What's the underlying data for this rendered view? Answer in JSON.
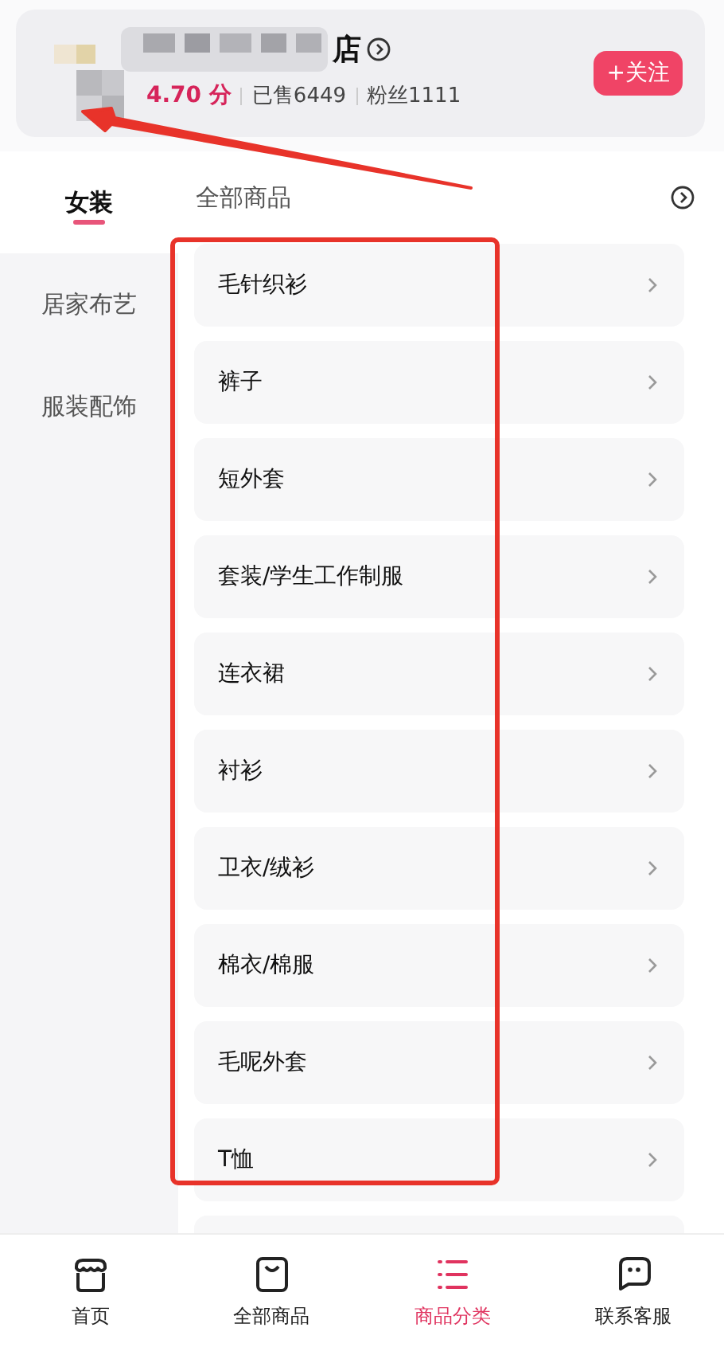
{
  "shop": {
    "name_visible": "店",
    "rating": "4.70 分",
    "sold": "已售6449",
    "fans": "粉丝1111",
    "follow_button": "+关注"
  },
  "sidebar": {
    "items": [
      {
        "label": "女装",
        "selected": true
      },
      {
        "label": "居家布艺",
        "selected": false
      },
      {
        "label": "服装配饰",
        "selected": false
      }
    ]
  },
  "category_header": {
    "title": "全部商品"
  },
  "categories": [
    {
      "label": "毛针织衫"
    },
    {
      "label": "裤子"
    },
    {
      "label": "短外套"
    },
    {
      "label": "套装/学生工作制服"
    },
    {
      "label": "连衣裙"
    },
    {
      "label": "衬衫"
    },
    {
      "label": "卫衣/绒衫"
    },
    {
      "label": "棉衣/棉服"
    },
    {
      "label": "毛呢外套"
    },
    {
      "label": "T恤"
    }
  ],
  "tab_bar": [
    {
      "label": "首页",
      "kind": "store",
      "selected": false
    },
    {
      "label": "全部商品",
      "kind": "bag",
      "selected": false
    },
    {
      "label": "商品分类",
      "kind": "list",
      "selected": true
    },
    {
      "label": "联系客服",
      "kind": "chat",
      "selected": false
    }
  ],
  "annotations": {
    "highlight_frame": true,
    "arrow": true
  }
}
